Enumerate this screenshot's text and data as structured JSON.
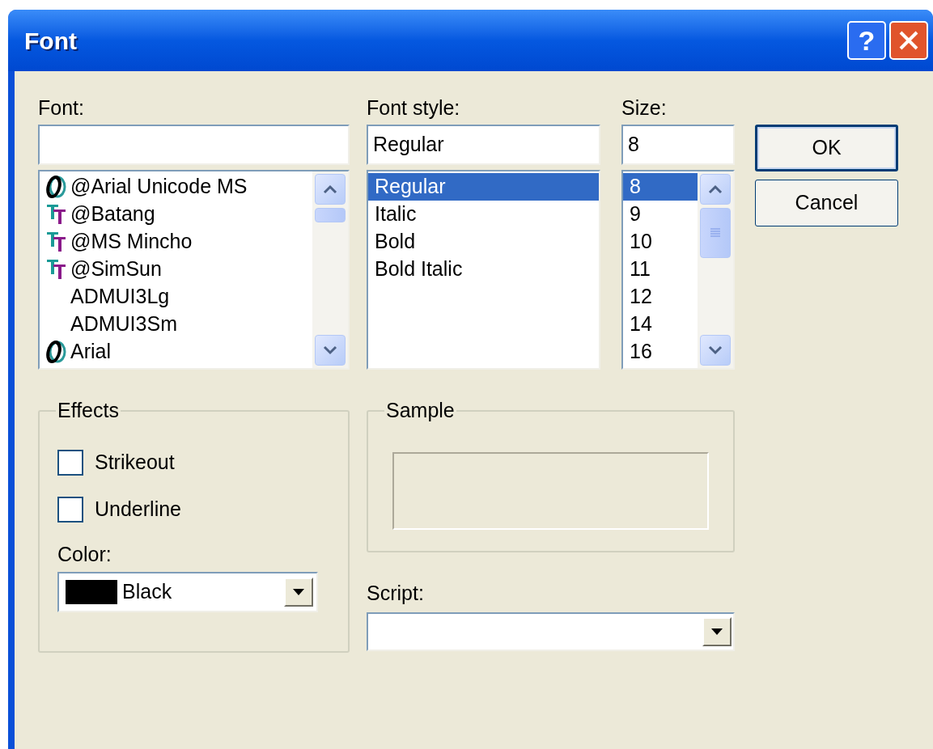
{
  "window": {
    "title": "Font",
    "help_button": "?"
  },
  "font": {
    "label": "Font:",
    "items": [
      {
        "name": "@Arial Unicode MS",
        "kind": "opentype",
        "selected": false
      },
      {
        "name": "@Batang",
        "kind": "truetype",
        "selected": false
      },
      {
        "name": "@MS Mincho",
        "kind": "truetype",
        "selected": false
      },
      {
        "name": "@SimSun",
        "kind": "truetype",
        "selected": false
      },
      {
        "name": "ADMUI3Lg",
        "kind": "raster",
        "selected": false
      },
      {
        "name": "ADMUI3Sm",
        "kind": "raster",
        "selected": false
      },
      {
        "name": "Arial",
        "kind": "opentype",
        "selected": false
      }
    ]
  },
  "font_style": {
    "label": "Font style:",
    "value": "Regular",
    "items": [
      {
        "name": "Regular",
        "selected": true
      },
      {
        "name": "Italic",
        "selected": false
      },
      {
        "name": "Bold",
        "selected": false
      },
      {
        "name": "Bold Italic",
        "selected": false
      }
    ]
  },
  "size": {
    "label": "Size:",
    "value": "8",
    "items": [
      {
        "name": "8",
        "selected": true
      },
      {
        "name": "9",
        "selected": false
      },
      {
        "name": "10",
        "selected": false
      },
      {
        "name": "11",
        "selected": false
      },
      {
        "name": "12",
        "selected": false
      },
      {
        "name": "14",
        "selected": false
      },
      {
        "name": "16",
        "selected": false
      }
    ]
  },
  "buttons": [
    {
      "label": "OK",
      "default": true
    },
    {
      "label": "Cancel",
      "default": false
    }
  ],
  "effects": {
    "title": "Effects",
    "options": [
      {
        "label": "Strikeout",
        "checked": false
      },
      {
        "label": "Underline",
        "checked": false
      }
    ],
    "color": {
      "label": "Color:",
      "value": "Black",
      "color": "#000000"
    }
  },
  "sample": {
    "title": "Sample"
  },
  "script": {
    "label": "Script:"
  }
}
